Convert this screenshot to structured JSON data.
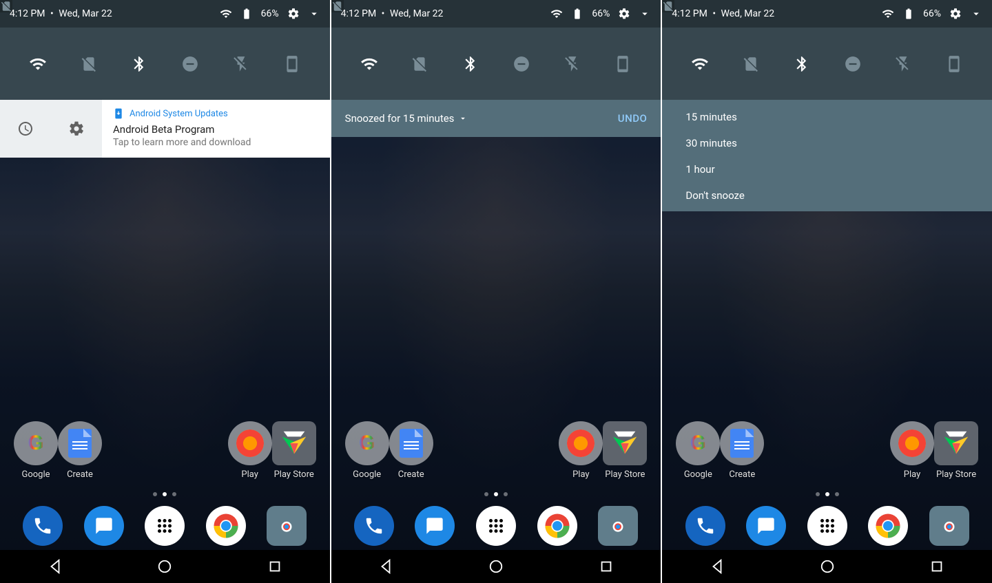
{
  "statusbar": {
    "time": "4:12 PM",
    "date": "Wed, Mar 22",
    "battery_pct": "66%"
  },
  "qs_tiles": {
    "wifi": "wifi-icon",
    "sim": "no-sim-icon",
    "bt": "bluetooth-icon",
    "dnd": "do-not-disturb-icon",
    "flash": "flashlight-icon",
    "portrait": "portrait-orientation-icon"
  },
  "notification": {
    "app_name": "Android System Updates",
    "title": "Android Beta Program",
    "subtitle": "Tap to learn more and download"
  },
  "snooze": {
    "label": "Snoozed for 15 minutes",
    "undo": "UNDO",
    "options": {
      "o1": "15 minutes",
      "o2": "30 minutes",
      "o3": "1 hour",
      "o4": "Don't snooze"
    }
  },
  "home_apps": {
    "a1": "Google",
    "a2": "Create",
    "a3": "Play",
    "a4": "Play Store"
  },
  "dock": {
    "phone": "phone-icon",
    "messages": "messages-icon",
    "drawer": "app-drawer-icon",
    "chrome": "chrome-icon",
    "camera": "camera-icon"
  },
  "nav": {
    "back": "back-icon",
    "home": "home-icon",
    "recents": "recents-icon"
  }
}
